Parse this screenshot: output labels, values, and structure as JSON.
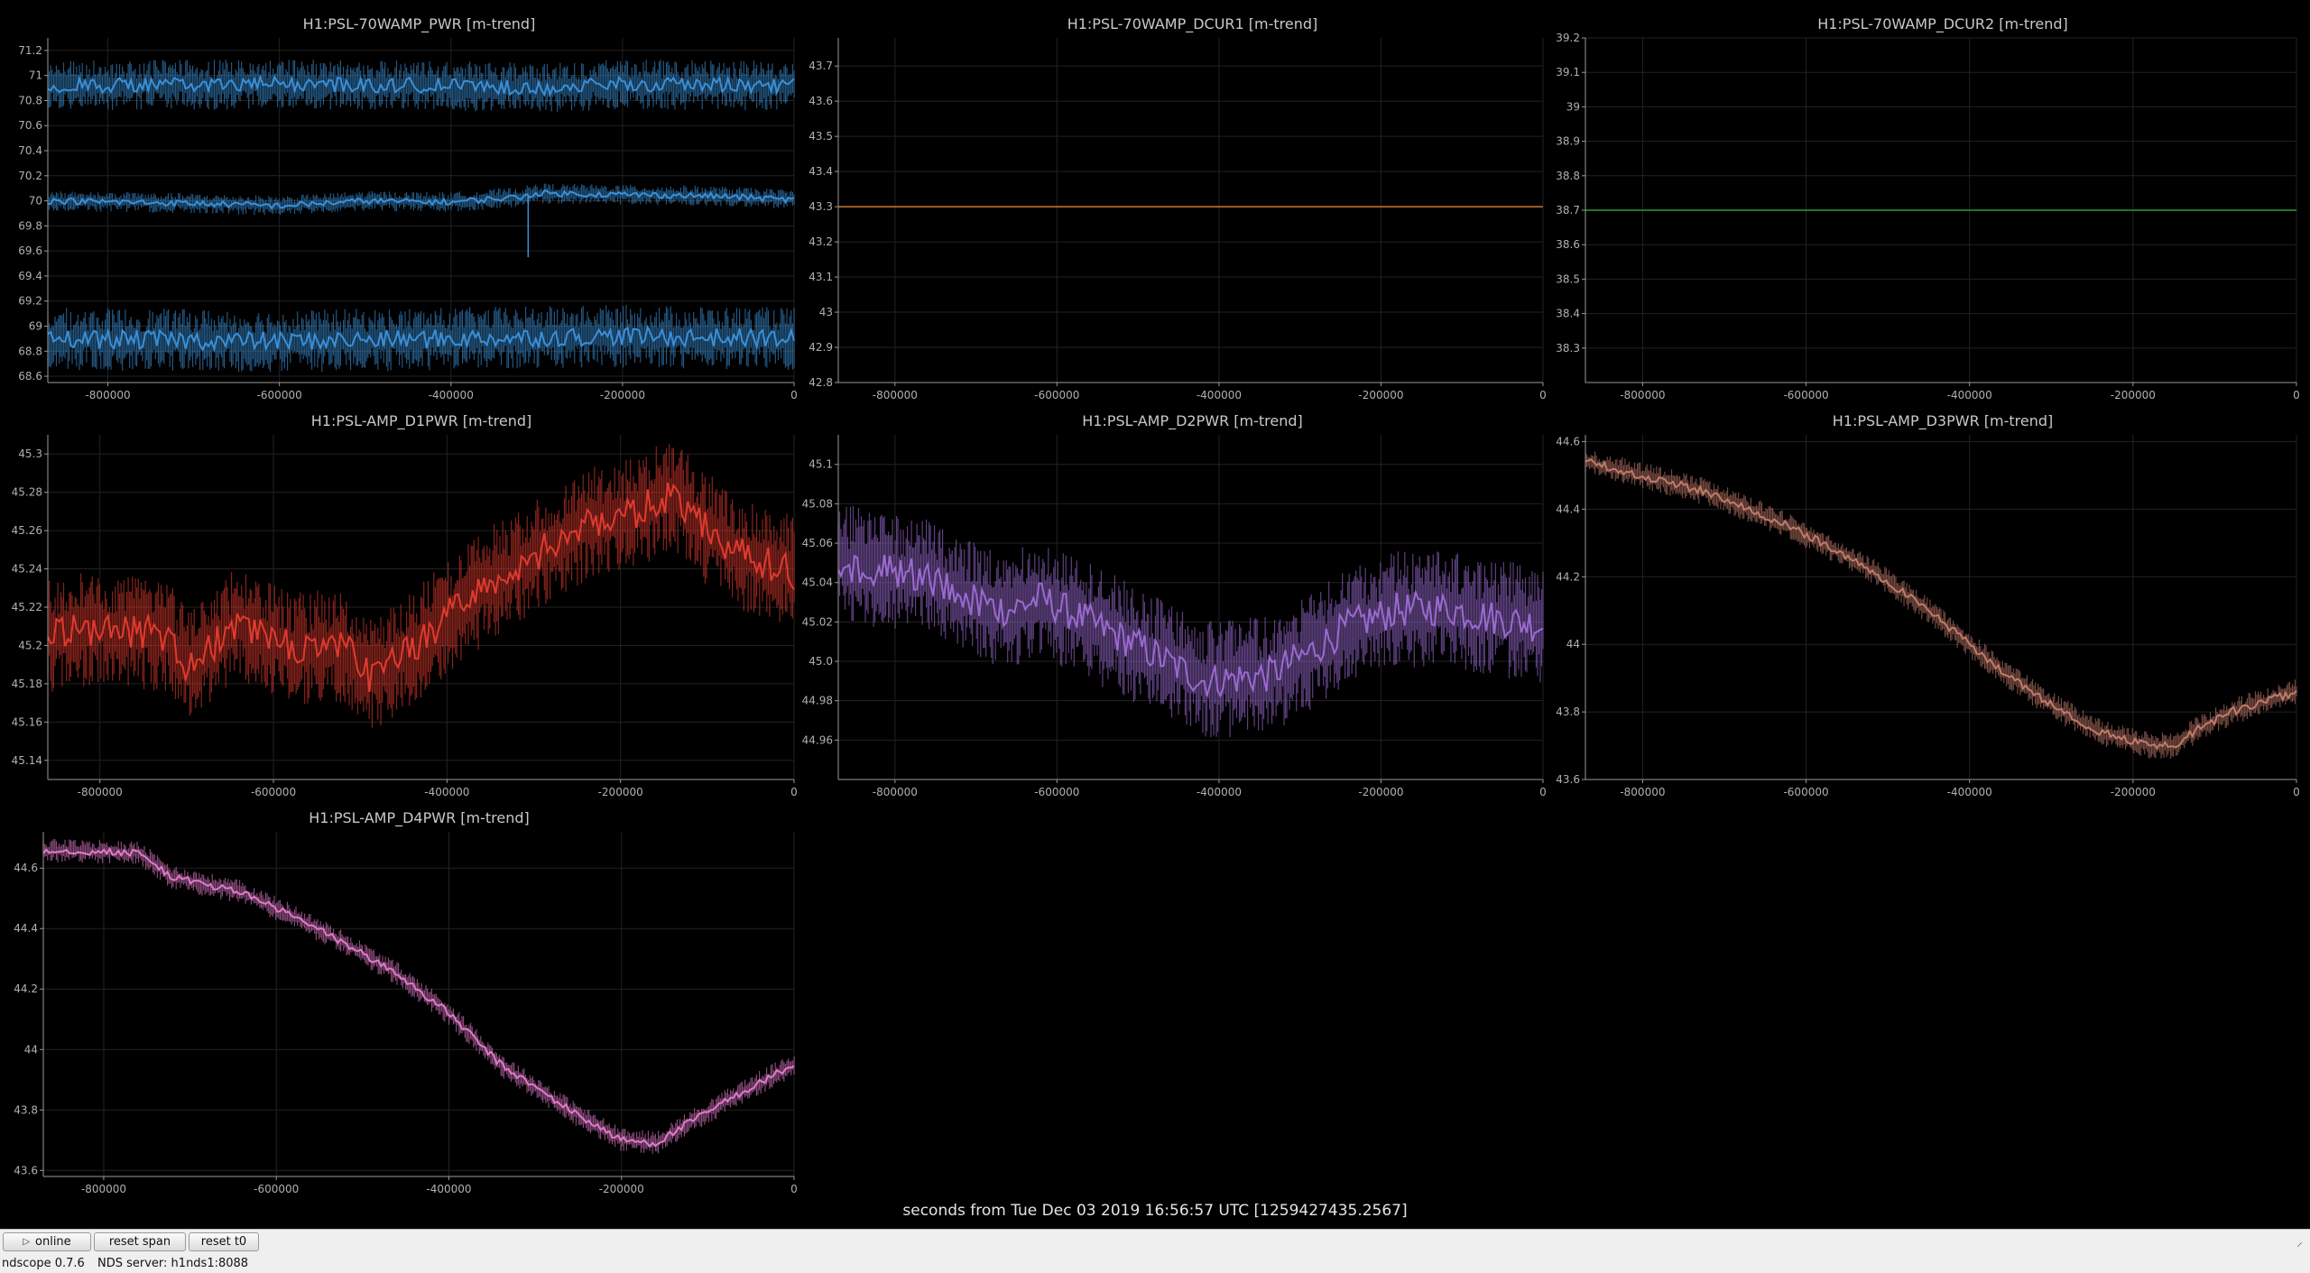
{
  "app": {
    "version_label": "ndscope 0.7.6",
    "server_label": "NDS server: h1nds1:8088"
  },
  "controls": {
    "online_label": "online",
    "online_icon": "play-icon",
    "reset_span_label": "reset span",
    "reset_t0_label": "reset t0"
  },
  "time_axis_label": "seconds from Tue Dec 03 2019 16:56:57 UTC [1259427435.2567]",
  "chart_data": [
    {
      "type": "line",
      "title": "H1:PSL-70WAMP_PWR [m-trend]",
      "color": "#3a8fd6",
      "xlim": [
        -870000,
        0
      ],
      "x_ticks": [
        "-800000",
        "-600000",
        "-400000",
        "-200000",
        "0"
      ],
      "x_tick_values": [
        -800000,
        -600000,
        -400000,
        -200000,
        0
      ],
      "ylim": [
        68.55,
        71.3
      ],
      "y_ticks": [
        "68.6",
        "68.8",
        "69",
        "69.2",
        "69.4",
        "69.6",
        "69.8",
        "70",
        "70.2",
        "70.4",
        "70.6",
        "70.8",
        "71",
        "71.2"
      ],
      "y_tick_values": [
        68.6,
        68.8,
        69,
        69.2,
        69.4,
        69.6,
        69.8,
        70,
        70.2,
        70.4,
        70.6,
        70.8,
        71,
        71.2
      ],
      "series": [
        {
          "role": "max",
          "x": [
            -870000,
            -600000,
            -400000,
            -300000,
            -200000,
            0
          ],
          "y": [
            70.92,
            70.93,
            70.92,
            70.9,
            70.93,
            70.92
          ],
          "band": 0.2
        },
        {
          "role": "mean",
          "x": [
            -870000,
            -700000,
            -600000,
            -500000,
            -400000,
            -320000,
            -300000,
            -200000,
            -100000,
            0
          ],
          "y": [
            70.0,
            69.98,
            69.96,
            70.0,
            69.99,
            70.03,
            70.06,
            70.05,
            70.04,
            70.01
          ],
          "band": 0.08,
          "spike_at": -310000,
          "spike_to": 69.55
        },
        {
          "role": "min",
          "x": [
            -870000,
            -600000,
            -400000,
            -200000,
            0
          ],
          "y": [
            68.9,
            68.88,
            68.9,
            68.92,
            68.9
          ],
          "band": 0.25
        }
      ]
    },
    {
      "type": "line",
      "title": "H1:PSL-70WAMP_DCUR1 [m-trend]",
      "color": "#d0772e",
      "xlim": [
        -870000,
        0
      ],
      "x_ticks": [
        "-800000",
        "-600000",
        "-400000",
        "-200000",
        "0"
      ],
      "x_tick_values": [
        -800000,
        -600000,
        -400000,
        -200000,
        0
      ],
      "ylim": [
        42.8,
        43.78
      ],
      "y_ticks": [
        "42.8",
        "42.9",
        "43",
        "43.1",
        "43.2",
        "43.3",
        "43.4",
        "43.5",
        "43.6",
        "43.7"
      ],
      "y_tick_values": [
        42.8,
        42.9,
        43.0,
        43.1,
        43.2,
        43.3,
        43.4,
        43.5,
        43.6,
        43.7
      ],
      "series": [
        {
          "role": "mean",
          "x": [
            -870000,
            0
          ],
          "y": [
            43.3,
            43.3
          ],
          "band": 0
        }
      ]
    },
    {
      "type": "line",
      "title": "H1:PSL-70WAMP_DCUR2 [m-trend]",
      "color": "#2e9a34",
      "xlim": [
        -870000,
        0
      ],
      "x_ticks": [
        "-800000",
        "-600000",
        "-400000",
        "-200000",
        "0"
      ],
      "x_tick_values": [
        -800000,
        -600000,
        -400000,
        -200000,
        0
      ],
      "ylim": [
        38.2,
        39.2
      ],
      "y_ticks": [
        "38.3",
        "38.4",
        "38.5",
        "38.6",
        "38.7",
        "38.8",
        "38.9",
        "39",
        "39.1",
        "39.2"
      ],
      "y_tick_values": [
        38.3,
        38.4,
        38.5,
        38.6,
        38.7,
        38.8,
        38.9,
        39.0,
        39.1,
        39.2
      ],
      "series": [
        {
          "role": "mean",
          "x": [
            -870000,
            0
          ],
          "y": [
            38.7,
            38.7
          ],
          "band": 0
        }
      ]
    },
    {
      "type": "line",
      "title": "H1:PSL-AMP_D1PWR [m-trend]",
      "color": "#e03a2e",
      "xlim": [
        -860000,
        0
      ],
      "x_ticks": [
        "-800000",
        "-600000",
        "-400000",
        "-200000",
        "0"
      ],
      "x_tick_values": [
        -800000,
        -600000,
        -400000,
        -200000,
        0
      ],
      "ylim": [
        45.13,
        45.31
      ],
      "y_ticks": [
        "45.14",
        "45.16",
        "45.18",
        "45.2",
        "45.22",
        "45.24",
        "45.26",
        "45.28",
        "45.3"
      ],
      "y_tick_values": [
        45.14,
        45.16,
        45.18,
        45.2,
        45.22,
        45.24,
        45.26,
        45.28,
        45.3
      ],
      "series": [
        {
          "role": "mean",
          "x": [
            -860000,
            -800000,
            -720000,
            -700000,
            -640000,
            -580000,
            -520000,
            -490000,
            -440000,
            -400000,
            -340000,
            -290000,
            -240000,
            -180000,
            -140000,
            -100000,
            -60000,
            0
          ],
          "y": [
            45.205,
            45.21,
            45.205,
            45.188,
            45.212,
            45.198,
            45.2,
            45.183,
            45.198,
            45.215,
            45.236,
            45.25,
            45.262,
            45.27,
            45.28,
            45.26,
            45.248,
            45.238
          ],
          "band": 0.03
        }
      ]
    },
    {
      "type": "line",
      "title": "H1:PSL-AMP_D2PWR [m-trend]",
      "color": "#9a6ad0",
      "xlim": [
        -870000,
        0
      ],
      "x_ticks": [
        "-800000",
        "-600000",
        "-400000",
        "-200000",
        "0"
      ],
      "x_tick_values": [
        -800000,
        -600000,
        -400000,
        -200000,
        0
      ],
      "ylim": [
        44.94,
        45.115
      ],
      "y_ticks": [
        "44.96",
        "44.98",
        "45.0",
        "45.02",
        "45.04",
        "45.06",
        "45.08",
        "45.1"
      ],
      "y_tick_values": [
        44.96,
        44.98,
        45.0,
        45.02,
        45.04,
        45.06,
        45.08,
        45.1
      ],
      "series": [
        {
          "role": "mean",
          "x": [
            -870000,
            -760000,
            -700000,
            -660000,
            -620000,
            -560000,
            -500000,
            -420000,
            -340000,
            -290000,
            -240000,
            -180000,
            -120000,
            -60000,
            0
          ],
          "y": [
            45.05,
            45.043,
            45.03,
            45.026,
            45.032,
            45.02,
            45.008,
            44.99,
            44.993,
            45.004,
            45.018,
            45.026,
            45.027,
            45.022,
            45.018
          ],
          "band": 0.03
        }
      ]
    },
    {
      "type": "line",
      "title": "H1:PSL-AMP_D3PWR [m-trend]",
      "color": "#c07a6a",
      "xlim": [
        -870000,
        0
      ],
      "x_ticks": [
        "-800000",
        "-600000",
        "-400000",
        "-200000",
        "0"
      ],
      "x_tick_values": [
        -800000,
        -600000,
        -400000,
        -200000,
        0
      ],
      "ylim": [
        43.6,
        44.62
      ],
      "y_ticks": [
        "43.6",
        "43.8",
        "44",
        "44.2",
        "44.4",
        "44.6"
      ],
      "y_tick_values": [
        43.6,
        43.8,
        44.0,
        44.2,
        44.4,
        44.6
      ],
      "series": [
        {
          "role": "mean",
          "x": [
            -870000,
            -800000,
            -720000,
            -640000,
            -580000,
            -520000,
            -440000,
            -360000,
            -300000,
            -240000,
            -180000,
            -150000,
            -120000,
            -80000,
            -40000,
            0
          ],
          "y": [
            44.54,
            44.5,
            44.45,
            44.37,
            44.3,
            44.22,
            44.08,
            43.92,
            43.82,
            43.74,
            43.7,
            43.7,
            43.75,
            43.8,
            43.83,
            43.86
          ],
          "band": 0.04
        }
      ]
    },
    {
      "type": "line",
      "title": "H1:PSL-AMP_D4PWR [m-trend]",
      "color": "#e07ac8",
      "xlim": [
        -870000,
        0
      ],
      "x_ticks": [
        "-800000",
        "-600000",
        "-400000",
        "-200000",
        "0"
      ],
      "x_tick_values": [
        -800000,
        -600000,
        -400000,
        -200000,
        0
      ],
      "ylim": [
        43.58,
        44.72
      ],
      "y_ticks": [
        "43.6",
        "43.8",
        "44",
        "44.2",
        "44.4",
        "44.6"
      ],
      "y_tick_values": [
        43.6,
        43.8,
        44.0,
        44.2,
        44.4,
        44.6
      ],
      "series": [
        {
          "role": "mean",
          "x": [
            -870000,
            -760000,
            -720000,
            -640000,
            -580000,
            -520000,
            -460000,
            -400000,
            -340000,
            -260000,
            -200000,
            -160000,
            -120000,
            -60000,
            0
          ],
          "y": [
            44.66,
            44.65,
            44.57,
            44.52,
            44.44,
            44.35,
            44.25,
            44.12,
            43.95,
            43.8,
            43.7,
            43.69,
            43.76,
            43.86,
            43.95
          ],
          "band": 0.04
        }
      ]
    }
  ]
}
